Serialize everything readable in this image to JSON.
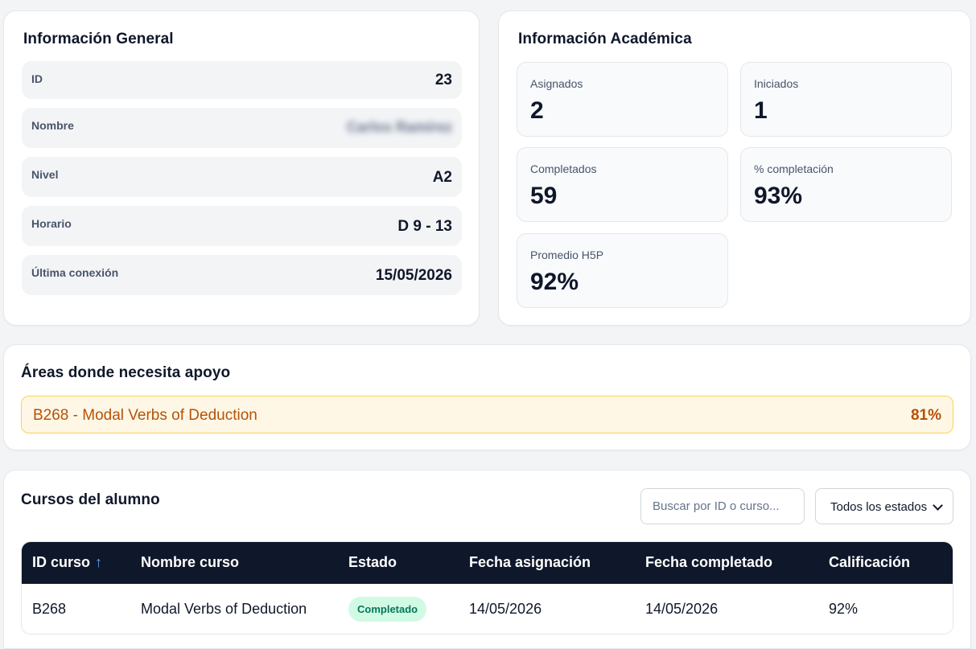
{
  "general": {
    "title": "Información General",
    "rows": [
      {
        "label": "ID",
        "value": "23"
      },
      {
        "label": "Nombre",
        "value": "Carlos Ramírez"
      },
      {
        "label": "Nivel",
        "value": "A2"
      },
      {
        "label": "Horario",
        "value": "D 9 - 13"
      },
      {
        "label": "Última conexión",
        "value": "15/05/2026"
      }
    ]
  },
  "academic": {
    "title": "Información Académica",
    "stats": [
      {
        "label": "Asignados",
        "value": "2"
      },
      {
        "label": "Iniciados",
        "value": "1"
      },
      {
        "label": "Completados",
        "value": "59"
      },
      {
        "label": "% completación",
        "value": "93%"
      },
      {
        "label": "Promedio H5P",
        "value": "92%"
      }
    ]
  },
  "support": {
    "title": "Áreas donde necesita apoyo",
    "items": [
      {
        "name": "B268 - Modal Verbs of Deduction",
        "percent": "81%"
      }
    ]
  },
  "courses": {
    "title": "Cursos del alumno",
    "search_placeholder": "Buscar por ID o curso...",
    "status_filter": "Todos los estados",
    "sort_icon": "↑",
    "columns": [
      "ID curso",
      "Nombre curso",
      "Estado",
      "Fecha asignación",
      "Fecha completado",
      "Calificación"
    ],
    "rows": [
      {
        "id": "B268",
        "name": "Modal Verbs of Deduction",
        "status": "Completado",
        "assigned": "14/05/2026",
        "completed": "14/05/2026",
        "grade": "92%"
      }
    ]
  },
  "colors": {
    "header_bg": "#0f172a",
    "warning_text": "#b45309",
    "warning_bg": "#fff7e6",
    "success_bg": "#d1fae5",
    "success_text": "#047857"
  }
}
